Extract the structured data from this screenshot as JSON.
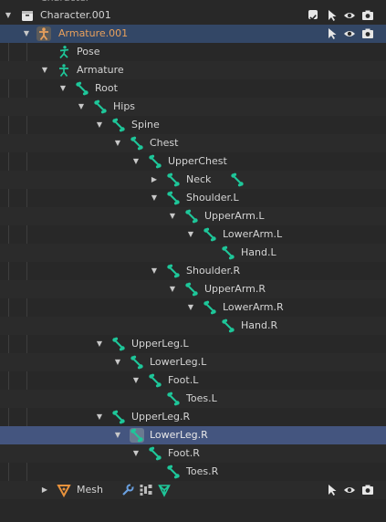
{
  "colors": {
    "bone": "#1ec79a",
    "armature_orange": "#e8a05c",
    "mesh_orange": "#e8923c",
    "active_row": "#334766",
    "selected_row": "#44557f"
  },
  "outliner": {
    "top_partial": {
      "label": "Character",
      "icon": "collection-icon"
    },
    "character": {
      "label": "Character.001",
      "icon": "collection-icon"
    },
    "armature_object": {
      "label": "Armature.001",
      "icon": "armature-object-icon"
    },
    "pose": {
      "label": "Pose",
      "icon": "pose-icon"
    },
    "armature_data": {
      "label": "Armature",
      "icon": "armature-data-icon"
    },
    "bones": {
      "root": "Root",
      "hips": "Hips",
      "spine": "Spine",
      "chest": "Chest",
      "upper_chest": "UpperChest",
      "neck": "Neck",
      "shoulder_l": "Shoulder.L",
      "upper_arm_l": "UpperArm.L",
      "lower_arm_l": "LowerArm.L",
      "hand_l": "Hand.L",
      "shoulder_r": "Shoulder.R",
      "upper_arm_r": "UpperArm.R",
      "lower_arm_r": "LowerArm.R",
      "hand_r": "Hand.R",
      "upper_leg_l": "UpperLeg.L",
      "lower_leg_l": "LowerLeg.L",
      "foot_l": "Foot.L",
      "toes_l": "Toes.L",
      "upper_leg_r": "UpperLeg.R",
      "lower_leg_r": "LowerLeg.R",
      "foot_r": "Foot.R",
      "toes_r": "Toes.R"
    },
    "mesh": {
      "label": "Mesh",
      "icon": "mesh-object-icon",
      "modifiers": [
        "wrench-icon",
        "vertex-groups-icon",
        "mesh-data-icon"
      ]
    },
    "row_controls": [
      "checkbox-icon",
      "select-arrow-icon",
      "eye-icon",
      "camera-icon"
    ]
  }
}
